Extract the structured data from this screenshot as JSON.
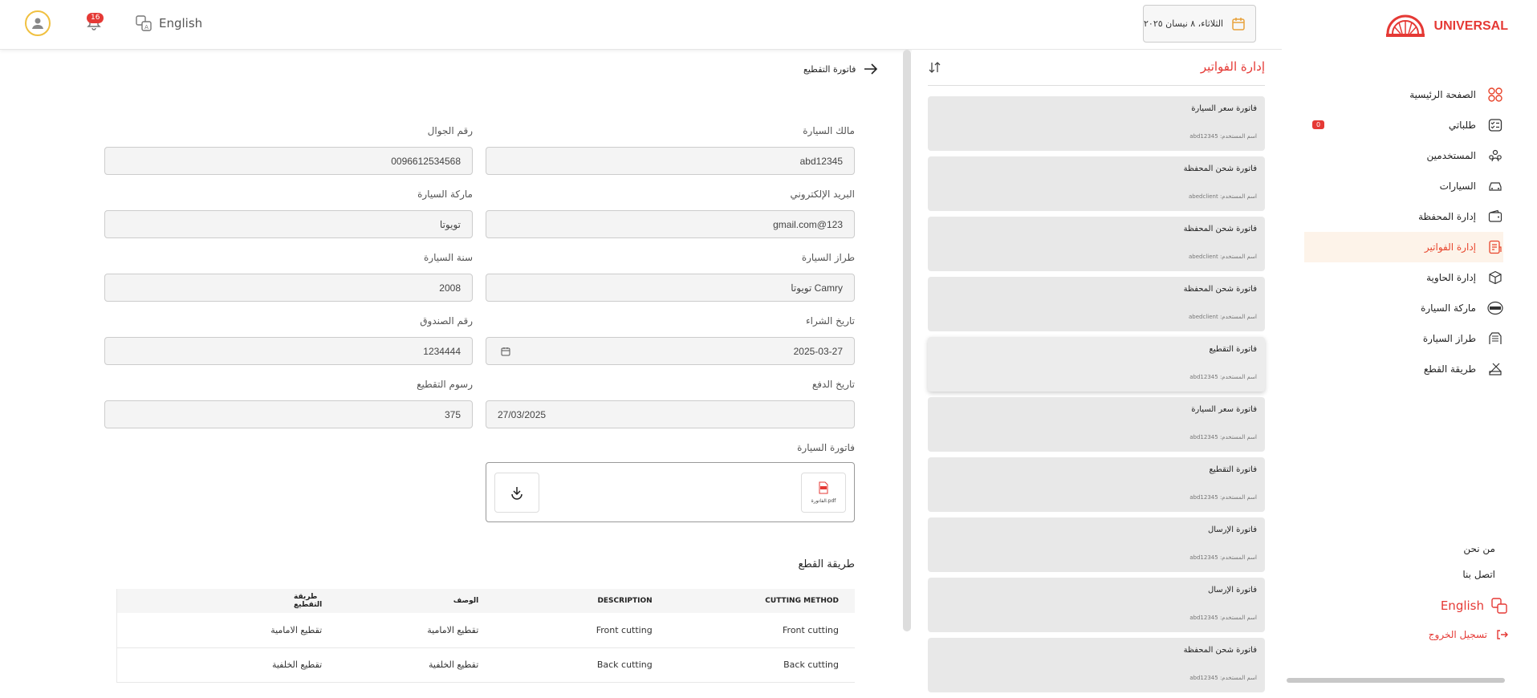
{
  "topbar": {
    "notifications_count": "16",
    "language": "English",
    "date": "الثلاثاء، ٨ نيسان ٢٠٢٥"
  },
  "sidebar": {
    "brand": "UNIVERSAL",
    "items": [
      {
        "label": "الصفحة الرئيسية",
        "icon": "grid-icon"
      },
      {
        "label": "طلباتي",
        "icon": "checklist-icon",
        "badge": "0"
      },
      {
        "label": "المستخدمين",
        "icon": "users-icon"
      },
      {
        "label": "السيارات",
        "icon": "car-icon"
      },
      {
        "label": "إدارة المحفظة",
        "icon": "wallet-icon"
      },
      {
        "label": "إدارة الفواتير",
        "icon": "invoice-icon",
        "active": true
      },
      {
        "label": "إدارة الحاوية",
        "icon": "box-icon"
      },
      {
        "label": "ماركة السيارة",
        "icon": "brand-icon"
      },
      {
        "label": "طراز السيارة",
        "icon": "car-model-icon"
      },
      {
        "label": "طريقة القطع",
        "icon": "cutting-icon"
      }
    ],
    "about": "من نحن",
    "contact": "اتصل بنا",
    "language": "English",
    "logout": "تسجيل الخروج"
  },
  "invoices_panel": {
    "title": "إدارة الفواتير",
    "username_prefix": "اسم المستخدم:",
    "cards": [
      {
        "title": "فاتورة سعر السيارة",
        "user": "abd12345"
      },
      {
        "title": "فاتورة شحن المحفظة",
        "user": "abedclient"
      },
      {
        "title": "فاتورة شحن المحفظة",
        "user": "abedclient"
      },
      {
        "title": "فاتورة شحن المحفظة",
        "user": "abedclient"
      },
      {
        "title": "فاتورة التقطيع",
        "user": "abd12345"
      },
      {
        "title": "فاتورة سعر السيارة",
        "user": "abd12345"
      },
      {
        "title": "فاتورة التقطيع",
        "user": "abd12345"
      },
      {
        "title": "فاتورة الإرسال",
        "user": "abd12345"
      },
      {
        "title": "فاتورة الإرسال",
        "user": "abd12345"
      },
      {
        "title": "فاتورة شحن المحفظة",
        "user": "abd12345"
      }
    ]
  },
  "detail": {
    "back_title": "فاتورة التقطيع",
    "fields": {
      "owner_label": "مالك السيارة",
      "owner": "abd12345",
      "phone_label": "رقم الجوال",
      "phone": "0096612534568",
      "email_label": "البريد الإلكتروني",
      "email": "gmail.com@123",
      "brand_label": "ماركة السيارة",
      "brand": "تويوتا",
      "model_label": "طراز السيارة",
      "model": "تويوتا Camry",
      "year_label": "سنة السيارة",
      "year": "2008",
      "purchase_date_label": "تاريخ الشراء",
      "purchase_date": "2025-03-27",
      "box_label": "رقم الصندوق",
      "box": "1234444",
      "payment_date_label": "تاريخ الدفع",
      "payment_date": "27/03/2025",
      "cutting_fee_label": "رسوم التقطيع",
      "cutting_fee": "375",
      "car_invoice_label": "فاتورة السيارة",
      "pdf_name": "الفاتورة.pdf"
    },
    "cutting_section": "طريقة القطع",
    "table": {
      "headers": [
        "CUTTING METHOD",
        "DESCRIPTION",
        "الوصف",
        "طريقة التقطيع"
      ],
      "rows": [
        [
          "Front cutting",
          "Front cutting",
          "تقطيع الامامية",
          "تقطيع الامامية"
        ],
        [
          "Back cutting",
          "Back cutting",
          "تقطيع الخلفية",
          "تقطيع الخلفية"
        ]
      ]
    }
  }
}
